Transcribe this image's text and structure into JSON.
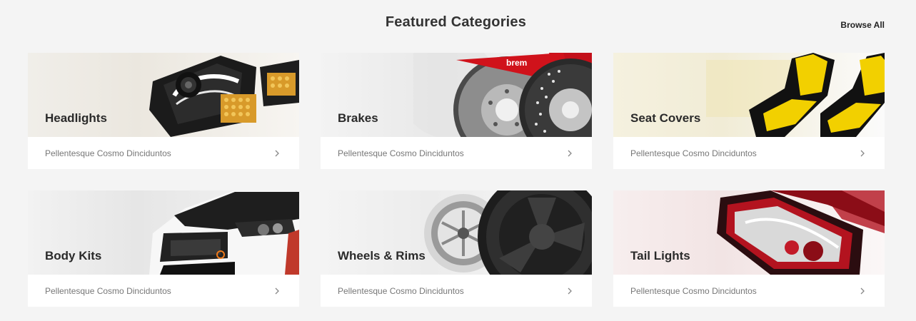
{
  "header": {
    "title": "Featured Categories",
    "browse_all": "Browse All"
  },
  "categories": [
    {
      "name": "Headlights",
      "subtitle": "Pellentesque Cosmo Dinciduntos",
      "icon": "headlight-image"
    },
    {
      "name": "Brakes",
      "subtitle": "Pellentesque Cosmo Dinciduntos",
      "icon": "brake-rotor-image"
    },
    {
      "name": "Seat Covers",
      "subtitle": "Pellentesque Cosmo Dinciduntos",
      "icon": "seat-image"
    },
    {
      "name": "Body Kits",
      "subtitle": "Pellentesque Cosmo Dinciduntos",
      "icon": "car-front-image"
    },
    {
      "name": "Wheels & Rims",
      "subtitle": "Pellentesque Cosmo Dinciduntos",
      "icon": "wheel-image"
    },
    {
      "name": "Tail Lights",
      "subtitle": "Pellentesque Cosmo Dinciduntos",
      "icon": "tail-light-image"
    }
  ],
  "colors": {
    "background": "#f4f4f4",
    "card": "#ffffff",
    "title": "#333333",
    "subtitle": "#777777",
    "brake_caliper": "#d0121b",
    "seat_yellow": "#f2d000",
    "tail_red": "#b3131f"
  }
}
